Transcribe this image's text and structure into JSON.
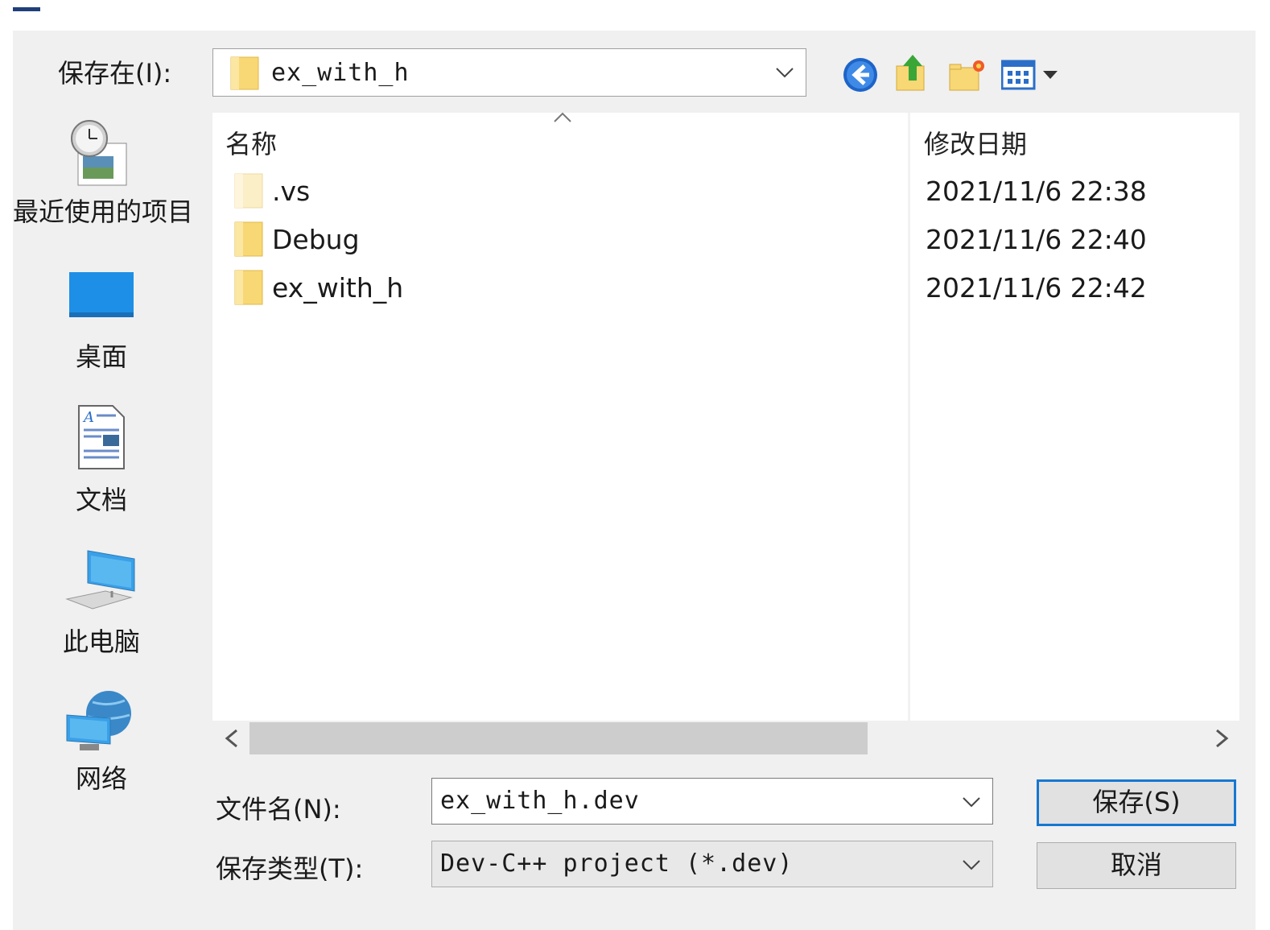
{
  "dialog": {
    "look_in_label": "保存在(I):",
    "look_in_value": "ex_with_h"
  },
  "toolbar": {
    "back_icon": "back-arrow-icon",
    "up_icon": "up-folder-icon",
    "new_folder_icon": "new-folder-icon",
    "view_icon": "view-menu-icon"
  },
  "places": [
    {
      "label": "最近使用的项目",
      "icon": "recent-items-icon"
    },
    {
      "label": "桌面",
      "icon": "desktop-icon"
    },
    {
      "label": "文档",
      "icon": "documents-icon"
    },
    {
      "label": "此电脑",
      "icon": "this-pc-icon"
    },
    {
      "label": "网络",
      "icon": "network-icon"
    }
  ],
  "list": {
    "columns": {
      "name": "名称",
      "modified": "修改日期"
    },
    "items": [
      {
        "name": ".vs",
        "modified": "2021/11/6 22:38",
        "hidden": true
      },
      {
        "name": "Debug",
        "modified": "2021/11/6 22:40",
        "hidden": false
      },
      {
        "name": "ex_with_h",
        "modified": "2021/11/6 22:42",
        "hidden": false
      }
    ]
  },
  "footer": {
    "filename_label": "文件名(N):",
    "filename_value": "ex_with_h.dev",
    "filetype_label": "保存类型(T):",
    "filetype_value": "Dev-C++ project (*.dev)",
    "save_label": "保存(S)",
    "cancel_label": "取消"
  },
  "colors": {
    "accent": "#1677d2",
    "folder": "#f8d775",
    "dialog_bg": "#f0f0f0"
  }
}
